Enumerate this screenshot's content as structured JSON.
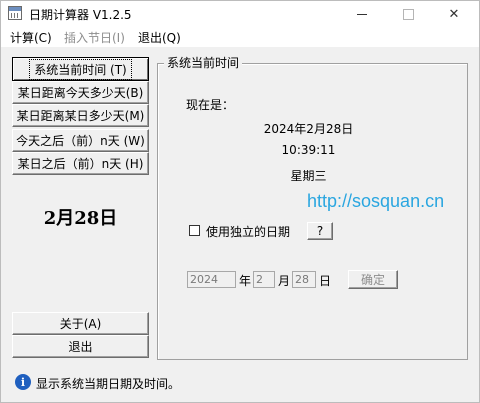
{
  "window": {
    "title": "日期计算器  V1.2.5",
    "controls": {
      "minimize": "—",
      "maximize": "□",
      "close": "✕"
    }
  },
  "menu": [
    {
      "label": "计算(C)",
      "enabled": true
    },
    {
      "label": "插入节日(I)",
      "enabled": false
    },
    {
      "label": "退出(Q)",
      "enabled": true
    }
  ],
  "left_buttons": [
    "系统当前时间   (T)",
    "某日距离今天多少天(B)",
    "某日距离某日多少天(M)",
    "今天之后（前）n天 (W)",
    "某日之后（前）n天 (H)"
  ],
  "big_date": "2月28日",
  "about_label": "关于(A)",
  "exit_label": "退出",
  "group": {
    "title": "系统当前时间",
    "now_label": "现在是：",
    "date": "2024年2月28日",
    "time": "10:39:11",
    "weekday": "星期三"
  },
  "watermark": "http://sosquan.cn",
  "independent_date": {
    "label": "使用独立的日期",
    "checked": false,
    "help_label": "?"
  },
  "date_inputs": {
    "year": "2024",
    "year_unit": "年",
    "month": "2",
    "month_unit": "月",
    "day": "28",
    "day_unit": "日",
    "confirm_label": "确定"
  },
  "status": {
    "icon": "info-icon",
    "icon_glyph": "i",
    "text": "显示系统当期日期及时间。"
  },
  "colors": {
    "watermark": "#2aa6e0",
    "info_icon": "#1f5fbf"
  }
}
